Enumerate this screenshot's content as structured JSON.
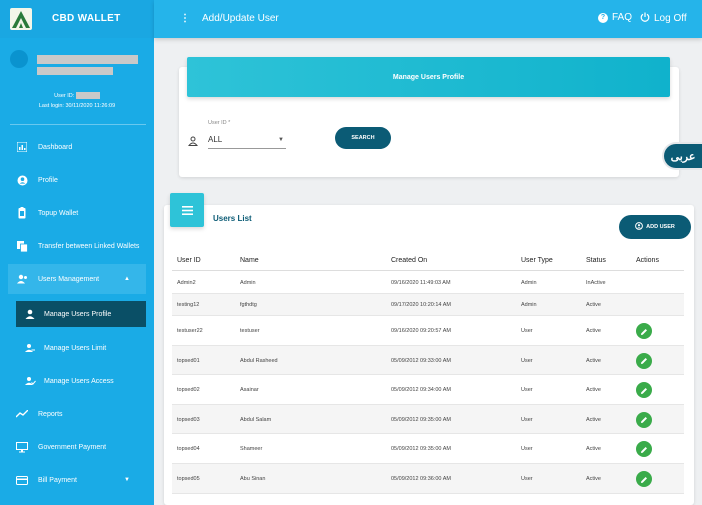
{
  "app": {
    "name": "CBD WALLET"
  },
  "user": {
    "id_label": "User ID:",
    "last_login": "Last login: 30/11/2020 11:26:09"
  },
  "header": {
    "title": "Add/Update User",
    "faq": "FAQ",
    "logout": "Log Off",
    "menu_icon": "vertical-dots-icon"
  },
  "sidebar": {
    "items": [
      {
        "label": "Dashboard",
        "icon": "dashboard-icon"
      },
      {
        "label": "Profile",
        "icon": "profile-icon"
      },
      {
        "label": "Topup Wallet",
        "icon": "wallet-icon"
      },
      {
        "label": "Transfer between Linked Wallets",
        "icon": "transfer-icon"
      },
      {
        "label": "Users Management",
        "icon": "users-icon"
      },
      {
        "label": "Manage Users Profile",
        "icon": "user-icon"
      },
      {
        "label": "Manage Users Limit",
        "icon": "limit-icon"
      },
      {
        "label": "Manage Users Access",
        "icon": "access-icon"
      },
      {
        "label": "Reports",
        "icon": "reports-icon"
      },
      {
        "label": "Government Payment",
        "icon": "monitor-icon"
      },
      {
        "label": "Bill Payment",
        "icon": "card-icon"
      }
    ]
  },
  "search": {
    "title": "Manage Users Profile",
    "field_label": "User ID *",
    "field_value": "ALL",
    "button": "SEARCH"
  },
  "lang": {
    "label": "عربى"
  },
  "list": {
    "title": "Users List",
    "add_button": "ADD USER",
    "columns": [
      "User ID",
      "Name",
      "Created On",
      "User Type",
      "Status",
      "Actions"
    ],
    "rows": [
      [
        "Admin2",
        "Admin",
        "09/16/2020 11:49:03 AM",
        "Admin",
        "InActive"
      ],
      [
        "testing12",
        "fgthdtg",
        "09/17/2020 10:20:14 AM",
        "Admin",
        "Active"
      ],
      [
        "testuser22",
        "testuser",
        "09/16/2020 09:20:57 AM",
        "User",
        "Active"
      ],
      [
        "topsed01",
        "Abdul Rasheed",
        "05/09/2012 09:33:00 AM",
        "User",
        "Active"
      ],
      [
        "topsed02",
        "Asainar",
        "05/09/2012 09:34:00 AM",
        "User",
        "Active"
      ],
      [
        "topsed03",
        "Abdul Salam",
        "05/09/2012 09:35:00 AM",
        "User",
        "Active"
      ],
      [
        "topsed04",
        "Shameer",
        "05/09/2012 09:35:00 AM",
        "User",
        "Active"
      ],
      [
        "topsed05",
        "Abu Sinan",
        "05/09/2012 09:36:00 AM",
        "User",
        "Active"
      ]
    ]
  },
  "colors": {
    "sidebar": "#1aabe6",
    "dark": "#0b5b75",
    "accent": "#2ec3d8",
    "edit": "#3aab4a"
  }
}
